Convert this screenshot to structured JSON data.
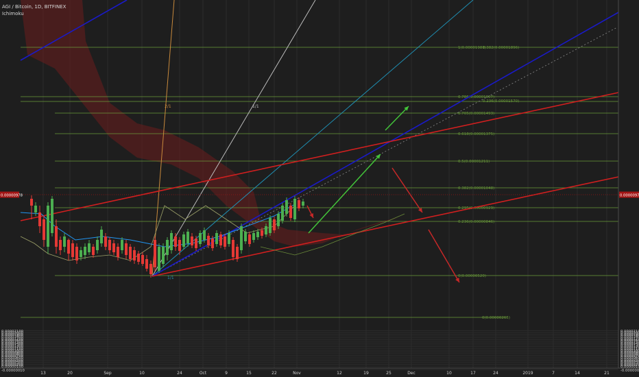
{
  "header": {
    "symbol_line": "AGI / Bitcoin, 1D, BITFINEX",
    "indicator": "Ichimoku"
  },
  "chart_data": {
    "type": "candlestick",
    "title": "AGI / Bitcoin, 1D, BITFINEX",
    "indicators": [
      "Ichimoku"
    ],
    "ylim": [
      -1e-07,
      2.125e-05
    ],
    "y_ticks": [
      {
        "value": -1e-07,
        "label": "-0.00000010"
      },
      {
        "value": 1e-07,
        "label": "0.00000100"
      },
      {
        "value": 2e-07,
        "label": "0.00000200"
      },
      {
        "value": 3e-07,
        "label": "0.00000300"
      },
      {
        "value": 4e-07,
        "label": "0.00000400"
      },
      {
        "value": 5e-07,
        "label": "0.00000500"
      },
      {
        "value": 6e-07,
        "label": "0.00000600"
      },
      {
        "value": 7e-07,
        "label": "0.00000700"
      },
      {
        "value": 8e-07,
        "label": "0.00000800"
      },
      {
        "value": 9e-07,
        "label": "0.00000900"
      },
      {
        "value": 1e-06,
        "label": "0.00001000"
      },
      {
        "value": 1.1e-06,
        "label": "0.00001100"
      },
      {
        "value": 1.2e-06,
        "label": "0.00001200"
      },
      {
        "value": 1.3e-06,
        "label": "0.00001300"
      },
      {
        "value": 1.4e-06,
        "label": "0.00001400"
      },
      {
        "value": 1.5e-06,
        "label": "0.00001500"
      },
      {
        "value": 1.6e-06,
        "label": "0.00001600"
      },
      {
        "value": 1.7e-06,
        "label": "0.00001700"
      },
      {
        "value": 1.8e-06,
        "label": "0.00001800"
      },
      {
        "value": 1.9e-06,
        "label": "0.00001900"
      },
      {
        "value": 2e-06,
        "label": "0.00002000"
      },
      {
        "value": 2.1e-06,
        "label": "0.00002100"
      }
    ],
    "current_price_label": "0.00000978",
    "x_ticks": [
      "13",
      "20",
      "Sep",
      "10",
      "24",
      "Oct",
      "9",
      "15",
      "22",
      "Nov",
      "12",
      "19",
      "25",
      "Dec",
      "10",
      "17",
      "24",
      "2019",
      "7",
      "14",
      "21"
    ],
    "fib_levels": [
      {
        "label": "1(0.00001981)",
        "label2": "0.382(0.00001896)"
      },
      {
        "label": "0.786(0.00001607)",
        "label2": "0.236(0.00001570)"
      },
      {
        "label": "0.705(0.00001493)"
      },
      {
        "label": "0.618(0.00001375)"
      },
      {
        "label": "0.5(0.00001211)"
      },
      {
        "label": "0.382(0.00001048)"
      },
      {
        "label": "0.295(0.00000929)"
      },
      {
        "label": "0.236(0.00000846)"
      },
      {
        "label": "0(0.00000520)"
      },
      {
        "label": "0(0.00000265)"
      }
    ],
    "fan_labels": [
      "2/1",
      "1/1"
    ],
    "anchor_label": "1/1"
  },
  "colors": {
    "background": "#1e1e1e",
    "grid": "#2c2c2c",
    "up": "#4caf50",
    "down": "#e53935",
    "fib": "#6b9d3a",
    "price_tag": "#a31515",
    "cloud": "#6b1e1e",
    "arrow_green": "#43c43a",
    "arrow_red": "#c62828"
  }
}
